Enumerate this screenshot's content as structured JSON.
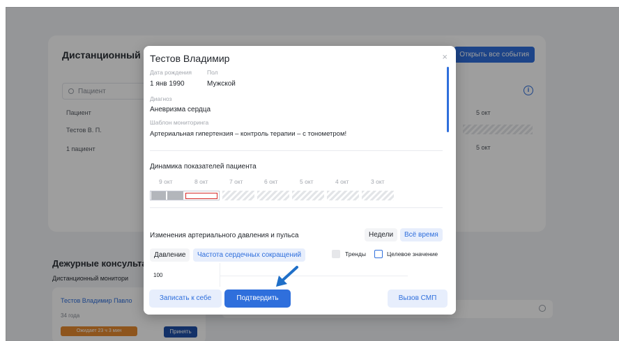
{
  "background": {
    "card_title": "Дистанционный мо",
    "open_all_events": "Открыть все события",
    "search_placeholder": "Пациент",
    "col_patient": "Пациент",
    "row_patient": "Тестов В. П.",
    "count": "1 пациент",
    "date_col1": "5 окт",
    "date_col2": "5 окт",
    "duty_title": "Дежурные консульта",
    "duty_subtitle": "Дистанционный монитори",
    "duty_card": {
      "name": "Тестов Владимир Павло",
      "age": "34 года",
      "waiting": "Ожидает 23 ч 3 мин",
      "accept": "Принять"
    }
  },
  "modal": {
    "title": "Тестов Владимир",
    "birth_label": "Дата рождения",
    "birth_value": "1 янв 1990",
    "sex_label": "Пол",
    "sex_value": "Мужской",
    "diagnosis_label": "Диагноз",
    "diagnosis_value": "Аневризма сердца",
    "template_label": "Шаблон мониторинга",
    "template_value": "Артериальная гипертензия – контроль терапии – с тонометром!",
    "dynamics_title": "Динамика показателей пациента",
    "dates": [
      "9 окт",
      "8 окт",
      "7 окт",
      "6 окт",
      "5 окт",
      "4 окт",
      "3 окт"
    ],
    "pressure_title": "Изменения артериального давления и пульса",
    "period_weeks": "Недели",
    "period_all": "Всё время",
    "tab_pressure": "Давление",
    "tab_hr": "Частота сердечных сокращений",
    "trends": "Тренды",
    "target": "Целевое значение",
    "axis_value": "100",
    "btn_record": "Записать к себе",
    "btn_confirm": "Подтвердить",
    "btn_ambulance": "Вызов СМП"
  },
  "colors": {
    "accent": "#2f6fdc",
    "arrow": "#1f6fc8",
    "highlight_border": "#d62828",
    "waiting_badge": "#e58a2f"
  }
}
